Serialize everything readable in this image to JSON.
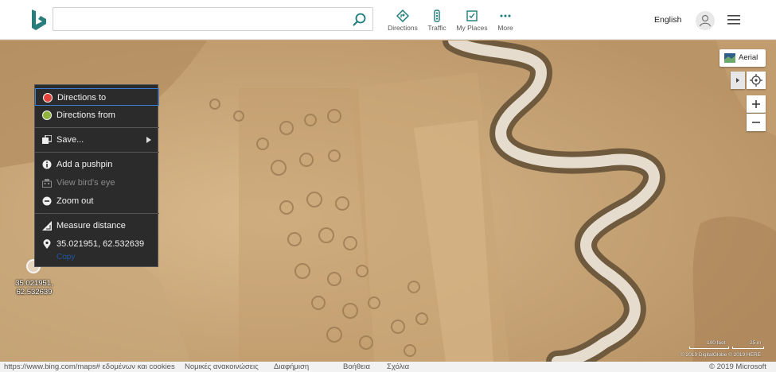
{
  "header": {
    "search": {
      "value": "",
      "placeholder": ""
    },
    "nav": [
      {
        "label": "Directions",
        "icon": "directions-icon"
      },
      {
        "label": "Traffic",
        "icon": "traffic-icon"
      },
      {
        "label": "My Places",
        "icon": "my-places-icon"
      },
      {
        "label": "More",
        "icon": "more-icon"
      }
    ],
    "language": "English"
  },
  "map_controls": {
    "aerial_label": "Aerial"
  },
  "context_menu": {
    "items": [
      {
        "label": "Directions to",
        "icon": "red-dot-icon",
        "enabled": true
      },
      {
        "label": "Directions from",
        "icon": "green-dot-icon",
        "enabled": true
      },
      {
        "label": "Save...",
        "icon": "save-icon",
        "enabled": true
      },
      {
        "label": "Add a pushpin",
        "icon": "info-icon",
        "enabled": true
      },
      {
        "label": "View bird's eye",
        "icon": "birds-eye-icon",
        "enabled": false
      },
      {
        "label": "Zoom out",
        "icon": "minus-circle-icon",
        "enabled": true
      },
      {
        "label": "Measure distance",
        "icon": "ruler-icon",
        "enabled": true
      },
      {
        "label": "35.021951, 62.532639",
        "icon": "location-pin-icon",
        "enabled": true
      }
    ],
    "copy_label": "Copy",
    "colors": {
      "directions_to": "#e0443a",
      "directions_from": "#8fb33c",
      "highlight": "#3a7fd8"
    }
  },
  "pin_label_line1": "35.021951,",
  "pin_label_line2": "62.532639",
  "scale": {
    "feet": "100 feet",
    "meters": "25 m"
  },
  "attribution": "© 2019 DigitalGlobe  © 2019 HERE",
  "footer": {
    "url": "https://www.bing.com/maps# εδομένων και cookies",
    "links": [
      "Νομικές ανακοινώσεις",
      "Διαφήμιση",
      "Βοήθεια",
      "Σχόλια"
    ],
    "copyright": "© 2019 Microsoft"
  }
}
